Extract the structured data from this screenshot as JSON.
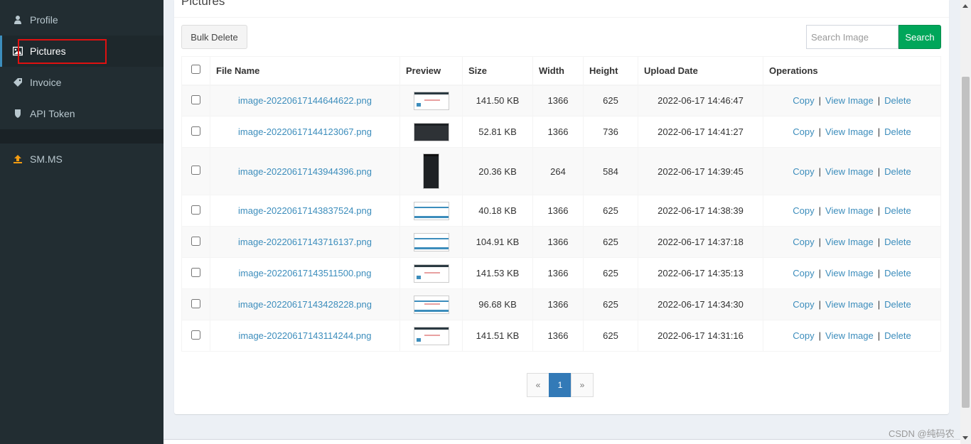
{
  "sidebar": {
    "items": [
      {
        "label": "Profile",
        "icon": "user-icon"
      },
      {
        "label": "Pictures",
        "icon": "image-icon"
      },
      {
        "label": "Invoice",
        "icon": "tag-icon"
      },
      {
        "label": "API Token",
        "icon": "shield-icon"
      },
      {
        "label": "SM.MS",
        "icon": "upload-icon"
      }
    ]
  },
  "page": {
    "title": "Pictures"
  },
  "toolbar": {
    "bulk_delete_label": "Bulk Delete",
    "search_placeholder": "Search Image",
    "search_label": "Search"
  },
  "table": {
    "headers": [
      "File Name",
      "Preview",
      "Size",
      "Width",
      "Height",
      "Upload Date",
      "Operations"
    ],
    "operations": {
      "copy": "Copy",
      "view": "View Image",
      "delete": "Delete",
      "sep": "|"
    },
    "rows": [
      {
        "name": "image-20220617144644622.png",
        "size": "141.50 KB",
        "width": "1366",
        "height": "625",
        "date": "2022-06-17 14:46:47"
      },
      {
        "name": "image-20220617144123067.png",
        "size": "52.81 KB",
        "width": "1366",
        "height": "736",
        "date": "2022-06-17 14:41:27"
      },
      {
        "name": "image-20220617143944396.png",
        "size": "20.36 KB",
        "width": "264",
        "height": "584",
        "date": "2022-06-17 14:39:45"
      },
      {
        "name": "image-20220617143837524.png",
        "size": "40.18 KB",
        "width": "1366",
        "height": "625",
        "date": "2022-06-17 14:38:39"
      },
      {
        "name": "image-20220617143716137.png",
        "size": "104.91 KB",
        "width": "1366",
        "height": "625",
        "date": "2022-06-17 14:37:18"
      },
      {
        "name": "image-20220617143511500.png",
        "size": "141.53 KB",
        "width": "1366",
        "height": "625",
        "date": "2022-06-17 14:35:13"
      },
      {
        "name": "image-20220617143428228.png",
        "size": "96.68 KB",
        "width": "1366",
        "height": "625",
        "date": "2022-06-17 14:34:30"
      },
      {
        "name": "image-20220617143114244.png",
        "size": "141.51 KB",
        "width": "1366",
        "height": "625",
        "date": "2022-06-17 14:31:16"
      }
    ]
  },
  "pagination": {
    "prev": "«",
    "current": "1",
    "next": "»"
  },
  "watermark": "CSDN @纯码农",
  "colors": {
    "sidebar_bg": "#222d32",
    "link": "#3c8dbc",
    "search_btn": "#00a65a",
    "active_page": "#337ab7"
  }
}
